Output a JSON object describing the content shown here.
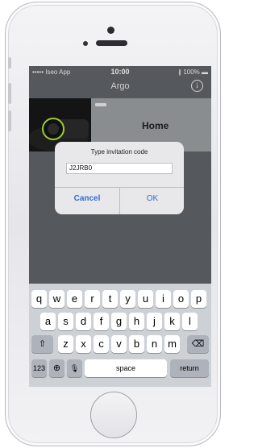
{
  "status_bar": {
    "carrier": "••••• Iseo App",
    "time": "10:00",
    "battery": "∦ 100% ▬"
  },
  "nav": {
    "title": "Argo",
    "info_icon": "i"
  },
  "lock": {
    "name": "Home"
  },
  "dialog": {
    "title": "Type invitation code",
    "input_value": "J2JRB0",
    "cancel_label": "Cancel",
    "ok_label": "OK"
  },
  "keyboard": {
    "row1": [
      "q",
      "w",
      "e",
      "r",
      "t",
      "y",
      "u",
      "i",
      "o",
      "p"
    ],
    "row2": [
      "a",
      "s",
      "d",
      "f",
      "g",
      "h",
      "j",
      "k",
      "l"
    ],
    "row3": [
      "z",
      "x",
      "c",
      "v",
      "b",
      "n",
      "m"
    ],
    "shift": "⇧",
    "delete": "⌫",
    "numbers": "123",
    "globe": "⊕",
    "mic": "🎙",
    "space": "space",
    "return": "return"
  }
}
